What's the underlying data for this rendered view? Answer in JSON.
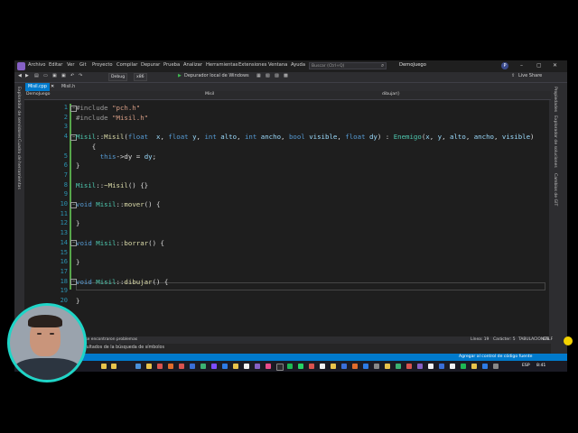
{
  "menubar": {
    "items": [
      "Archivo",
      "Editar",
      "Ver",
      "Git",
      "Proyecto",
      "Compilar",
      "Depurar",
      "Prueba",
      "Analizar",
      "Herramientas",
      "Extensiones",
      "Ventana",
      "Ayuda"
    ],
    "search_placeholder": "Buscar (Ctrl+Q)",
    "solution_name": "DemoJuego",
    "user_initial": "P"
  },
  "toolbar": {
    "config": "Debug",
    "platform": "x86",
    "run_label": "Depurador local de Windows",
    "live_share": "Live Share"
  },
  "left_rail": {
    "items": [
      "Explorador de servidores",
      "Cuadro de herramientas"
    ]
  },
  "right_rail": {
    "items": [
      "Propiedades",
      "Explorador de soluciones",
      "Cambios de GIT"
    ]
  },
  "tabs": [
    {
      "label": "Misil.cpp",
      "active": true
    },
    {
      "label": "Misil.h",
      "active": false
    }
  ],
  "navbar": {
    "project": "DemoJuego",
    "scope": "Misil",
    "member": "dibujar()"
  },
  "code_lines": [
    {
      "n": "1",
      "html": "<span class='pp'>#include</span> <span class='s'>\"pch.h\"</span>"
    },
    {
      "n": "2",
      "html": "<span class='pp'>#include</span> <span class='s'>\"Misil.h\"</span>"
    },
    {
      "n": "3",
      "html": ""
    },
    {
      "n": "4",
      "html": "<span class='t'>Misil</span>::<span class='f'>Misil</span>(<span class='k'>float</span>  <span class='p'>x</span>, <span class='k'>float</span> <span class='p'>y</span>, <span class='k'>int</span> <span class='p'>alto</span>, <span class='k'>int</span> <span class='p'>ancho</span>, <span class='k'>bool</span> <span class='p'>visible</span>, <span class='k'>float</span> <span class='p'>dy</span>) : <span class='t'>Enemigo</span>(<span class='p'>x</span>, <span class='p'>y</span>, <span class='p'>alto</span>, <span class='p'>ancho</span>, <span class='p'>visible</span>)"
    },
    {
      "n": "",
      "html": "    {"
    },
    {
      "n": "5",
      "html": "      <span class='k'>this</span>-><span class='m'>dy</span> = <span class='p'>dy</span>;"
    },
    {
      "n": "6",
      "html": "}"
    },
    {
      "n": "7",
      "html": ""
    },
    {
      "n": "8",
      "html": "<span class='t'>Misil</span>::<span class='f'>~Misil</span>() {}"
    },
    {
      "n": "9",
      "html": ""
    },
    {
      "n": "10",
      "html": "<span class='k'>void</span> <span class='t'>Misil</span>::<span class='f'>mover</span>() {"
    },
    {
      "n": "11",
      "html": ""
    },
    {
      "n": "12",
      "html": "}"
    },
    {
      "n": "13",
      "html": ""
    },
    {
      "n": "14",
      "html": "<span class='k'>void</span> <span class='t'>Misil</span>::<span class='f'>borrar</span>() {"
    },
    {
      "n": "15",
      "html": ""
    },
    {
      "n": "16",
      "html": "}"
    },
    {
      "n": "17",
      "html": ""
    },
    {
      "n": "18",
      "html": "<span class='k'>void</span> <span class='t'>Misil</span>::<span class='f'>dibujar</span>() {"
    },
    {
      "n": "19",
      "html": ""
    },
    {
      "n": "20",
      "html": "}"
    }
  ],
  "editor_status": {
    "problems": "No se encontraron problemas",
    "line": "Línea: 19",
    "col": "Carácter: 5",
    "tabs": "TABULACIONES",
    "eol": "CRLF"
  },
  "bottom_panel": {
    "label": "Resultados de la búsqueda de símbolos"
  },
  "status_bar": {
    "source_control": "Agregar al control de código fuente"
  },
  "taskbar": {
    "time": "8:41",
    "lang": "ESP"
  }
}
